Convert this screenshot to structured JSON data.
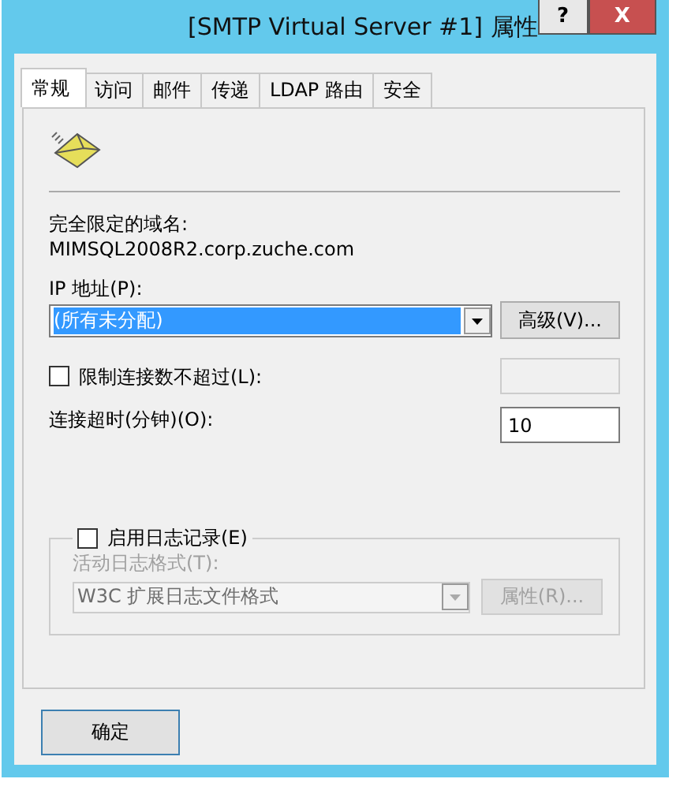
{
  "window": {
    "title": "[SMTP Virtual Server #1] 属性",
    "help": "?",
    "close": "X"
  },
  "tabs": [
    {
      "label": "常规",
      "selected": true
    },
    {
      "label": "访问",
      "selected": false
    },
    {
      "label": "邮件",
      "selected": false
    },
    {
      "label": "传递",
      "selected": false
    },
    {
      "label": "LDAP 路由",
      "selected": false
    },
    {
      "label": "安全",
      "selected": false
    }
  ],
  "fqdn_label": "完全限定的域名:",
  "fqdn": "MIMSQL2008R2.corp.zuche.com",
  "ip": {
    "label": "IP 地址(P):",
    "value": "(所有未分配)"
  },
  "advanced_button": "高级(V)...",
  "limit": {
    "label": "限制连接数不超过(L):",
    "checked": false
  },
  "timeout": {
    "label": "连接超时(分钟)(O):",
    "value": "10"
  },
  "logging": {
    "label": "启用日志记录(E)",
    "checked": false,
    "format_label": "活动日志格式(T):",
    "format": "W3C 扩展日志文件格式",
    "properties_button": "属性(R)..."
  },
  "buttons": [
    {
      "label": "确定",
      "default": true
    }
  ]
}
